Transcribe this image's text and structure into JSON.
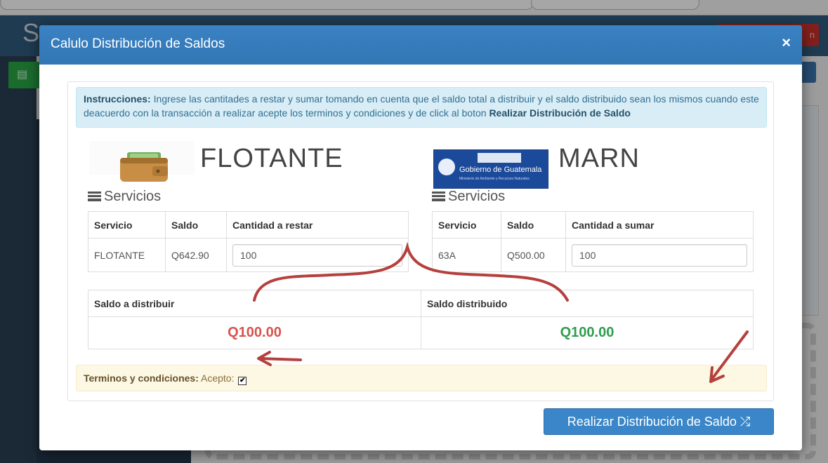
{
  "background": {
    "logo_letter": "S",
    "red_button_label": "n",
    "green_button_icon": "document-icon"
  },
  "modal": {
    "title": "Calulo Distribución de Saldos",
    "close_icon": "close-icon",
    "close_glyph": "×"
  },
  "instructions": {
    "label": "Instrucciones:",
    "text": " Ingrese las cantitades a restar y sumar tomando en cuenta que el saldo total a distribuir y el saldo distribuido sean los mismos cuando este deacuerdo con la transacción a realizar acepte los terminos y condiciones y de click al boton ",
    "action_name": "Realizar Distribución de Saldo"
  },
  "left": {
    "brand": "FLOTANTE",
    "section_title": "Servicios",
    "headers": [
      "Servicio",
      "Saldo",
      "Cantidad a restar"
    ],
    "row": {
      "servicio": "FLOTANTE",
      "saldo": "Q642.90",
      "cantidad": "100"
    }
  },
  "right": {
    "brand": "MARN",
    "logo_text": "Gobierno de Guatemala",
    "logo_subtext": "Ministerio de Ambiente y Recursos Naturales",
    "section_title": "Servicios",
    "headers": [
      "Servicio",
      "Saldo",
      "Cantidad a sumar"
    ],
    "row": {
      "servicio": "63A",
      "saldo": "Q500.00",
      "cantidad": "100"
    }
  },
  "totals": {
    "distribuir_label": "Saldo a distribuir",
    "distribuido_label": "Saldo distribuido",
    "distribuir_value": "Q100.00",
    "distribuido_value": "Q100.00"
  },
  "terms": {
    "label": "Terminos y condiciones:",
    "accept": " Acepto:",
    "checked": true,
    "check_glyph": "✔"
  },
  "submit": {
    "label": "Realizar Distribución de Saldo",
    "icon": "random-icon",
    "icon_glyph": "⤮"
  },
  "colors": {
    "header_blue": "#3276b4",
    "red_value": "#d9534f",
    "green_value": "#2e9e4f",
    "annotation": "#b5403e"
  }
}
